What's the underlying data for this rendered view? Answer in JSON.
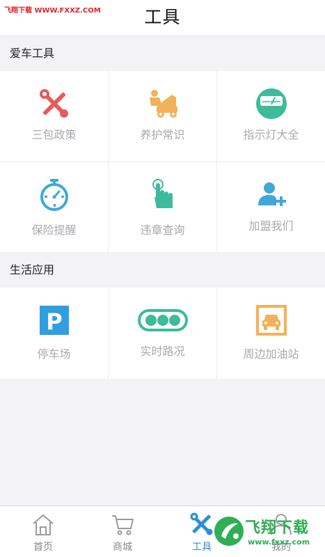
{
  "header": {
    "title": "工具",
    "watermark_brand": "飞翔下载",
    "watermark_site": "WWW.FXXZ.COM"
  },
  "sections": {
    "car_tools": {
      "title": "爱车工具",
      "items": [
        {
          "label": "三包政策",
          "icon": "tools-icon",
          "color": "#e65b5b"
        },
        {
          "label": "养护常识",
          "icon": "car-repair-icon",
          "color": "#f2b15a"
        },
        {
          "label": "指示灯大全",
          "icon": "gauge-icon",
          "color": "#3dbb9a"
        },
        {
          "label": "保险提醒",
          "icon": "stopwatch-icon",
          "color": "#3fa8d8"
        },
        {
          "label": "违章查询",
          "icon": "hand-pointer-icon",
          "color": "#3dbb9a"
        },
        {
          "label": "加盟我们",
          "icon": "add-user-icon",
          "color": "#3fa8d8"
        }
      ]
    },
    "life_apps": {
      "title": "生活应用",
      "items": [
        {
          "label": "停车场",
          "icon": "parking-icon",
          "color": "#2f9fe0"
        },
        {
          "label": "实时路况",
          "icon": "traffic-light-icon",
          "color": "#3dbb9a"
        },
        {
          "label": "周边加油站",
          "icon": "car-station-icon",
          "color": "#f2b15a"
        }
      ]
    }
  },
  "tabbar": {
    "tabs": [
      {
        "label": "首页",
        "icon": "home-icon",
        "active": false
      },
      {
        "label": "商城",
        "icon": "cart-icon",
        "active": false
      },
      {
        "label": "工具",
        "icon": "tools-icon",
        "active": true
      },
      {
        "label": "我的",
        "icon": "user-icon",
        "active": false
      }
    ],
    "active_color": "#2c8fd6"
  },
  "watermark_bottom": {
    "brand": "飞翔下载",
    "site": "www.fxxz.com"
  }
}
